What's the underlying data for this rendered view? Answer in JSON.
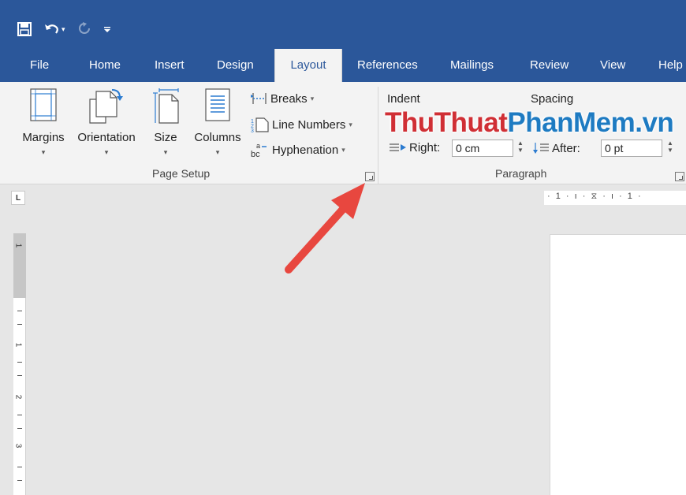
{
  "qat": {
    "save_icon": "save-icon",
    "undo_icon": "undo-icon",
    "redo_icon": "redo-icon",
    "customize_icon": "customize-qat-icon"
  },
  "tabs": [
    "File",
    "Home",
    "Insert",
    "Design",
    "Layout",
    "References",
    "Mailings",
    "Review",
    "View",
    "Help"
  ],
  "active_tab": "Layout",
  "page_setup": {
    "margins": "Margins",
    "orientation": "Orientation",
    "size": "Size",
    "columns": "Columns",
    "breaks": "Breaks",
    "line_numbers": "Line Numbers",
    "hyphenation": "Hyphenation",
    "group_label": "Page Setup"
  },
  "paragraph": {
    "indent_label": "Indent",
    "spacing_label": "Spacing",
    "right_label": "Right:",
    "right_value": "0 cm",
    "after_label": "After:",
    "after_value": "0 pt",
    "group_label": "Paragraph"
  },
  "watermark": {
    "part1": "ThuThuat",
    "part2": "PhanMem.vn"
  },
  "ruler": {
    "tab_selector": "L",
    "horizontal_text": "· 1 · ı · ⧖ · ı · 1 ·",
    "vertical_numbers": [
      "1",
      "1",
      "2",
      "3"
    ]
  },
  "colors": {
    "accent": "#2b579a",
    "ribbon": "#f3f3f3",
    "arrow": "#e8473f",
    "watermark_red": "#d02f35",
    "watermark_blue": "#1e7bc2"
  }
}
